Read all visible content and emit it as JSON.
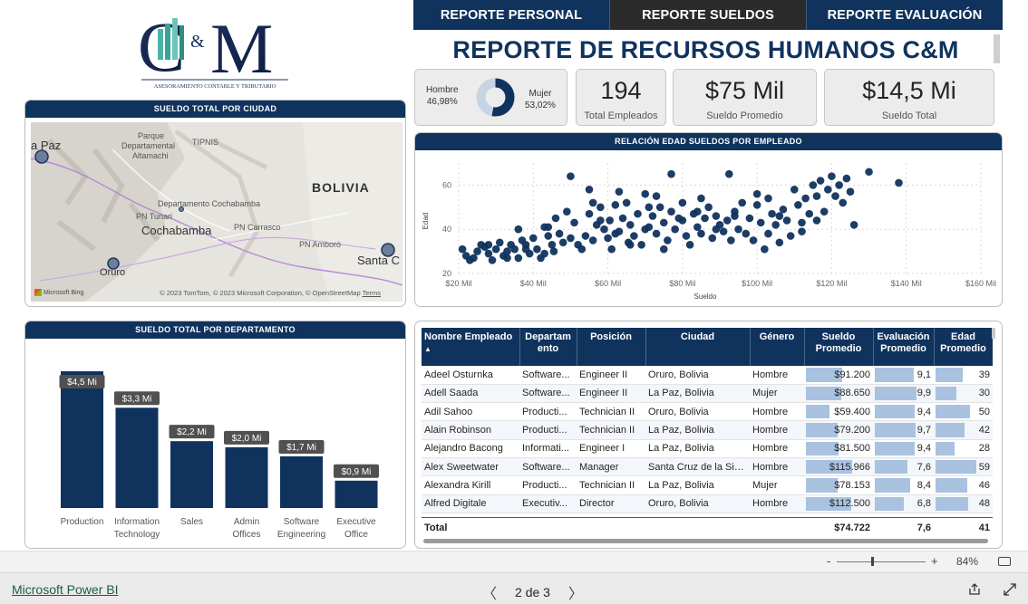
{
  "logo": {
    "mark": "C&M",
    "tagline": "ASESORAMIENTO CONTABLE Y TRIBUTARIO"
  },
  "nav": {
    "tabs": [
      {
        "label": "REPORTE PERSONAL",
        "active": false
      },
      {
        "label": "REPORTE SUELDOS",
        "active": true
      },
      {
        "label": "REPORTE EVALUACIÓN",
        "active": false
      }
    ]
  },
  "title": "REPORTE DE RECURSOS HUMANOS C&M",
  "gender": {
    "male_label": "Hombre",
    "male_pct": "46,98%",
    "male_share": 0.4698,
    "female_label": "Mujer",
    "female_pct": "53,02%",
    "female_share": 0.5302
  },
  "kpis": {
    "total_empleados": {
      "value": "194",
      "label": "Total Empleados"
    },
    "sueldo_promedio": {
      "value": "$75 Mil",
      "label": "Sueldo Promedio"
    },
    "sueldo_total": {
      "value": "$14,5 Mi",
      "label": "Sueldo Total"
    }
  },
  "map_panel": {
    "title": "SUELDO TOTAL POR CIUDAD",
    "labels": {
      "la_paz": "a Paz",
      "bolivia": "BOLIVIA",
      "parque": "Parque",
      "departamental": "Departamental",
      "altamachi": "Altamachi",
      "tipnis": "TIPNIS",
      "dep_cbba": "Departamento Cochabamba",
      "pn_tunari": "PN Tunari",
      "cochabamba": "Cochabamba",
      "pn_carrasco": "PN Carrasco",
      "pn_amboro": "PN Amboró",
      "oruro": "Oruro",
      "santa_cruz": "Santa C"
    },
    "bing": "Microsoft Bing",
    "credit": "© 2023 TomTom, © 2023 Microsoft Corporation, © OpenStreetMap",
    "terms": "Terms"
  },
  "scatter_panel": {
    "title": "RELACIÓN EDAD SUELDOS POR EMPLEADO"
  },
  "bar_panel": {
    "title": "SUELDO TOTAL POR DEPARTAMENTO"
  },
  "chart_data": [
    {
      "type": "scatter",
      "title": "RELACIÓN EDAD SUELDOS POR EMPLEADO",
      "xlabel": "Sueldo",
      "ylabel": "Edad",
      "xlim": [
        20000,
        160000
      ],
      "ylim": [
        20,
        70
      ],
      "xticks": [
        "$20 Mil",
        "$40 Mil",
        "$60 Mil",
        "$80 Mil",
        "$100 Mil",
        "$120 Mil",
        "$140 Mil",
        "$160 Mil"
      ],
      "yticks": [
        "20",
        "40",
        "60"
      ],
      "grid": true,
      "color": "#10335e",
      "points": [
        [
          21000,
          31
        ],
        [
          22000,
          28
        ],
        [
          23000,
          26
        ],
        [
          24000,
          27
        ],
        [
          25000,
          30
        ],
        [
          26000,
          33
        ],
        [
          27000,
          32
        ],
        [
          28000,
          29
        ],
        [
          29000,
          26
        ],
        [
          30000,
          31
        ],
        [
          31000,
          34
        ],
        [
          32000,
          28
        ],
        [
          33000,
          30
        ],
        [
          34000,
          33
        ],
        [
          35000,
          31
        ],
        [
          36000,
          27
        ],
        [
          37000,
          35
        ],
        [
          38000,
          33
        ],
        [
          39000,
          29
        ],
        [
          40000,
          36
        ],
        [
          41000,
          31
        ],
        [
          42000,
          27
        ],
        [
          43000,
          41
        ],
        [
          44000,
          37
        ],
        [
          45000,
          33
        ],
        [
          45500,
          30
        ],
        [
          46000,
          45
        ],
        [
          47000,
          38
        ],
        [
          48000,
          34
        ],
        [
          49000,
          48
        ],
        [
          50000,
          36
        ],
        [
          51000,
          43
        ],
        [
          52000,
          33
        ],
        [
          53000,
          31
        ],
        [
          54000,
          37
        ],
        [
          55000,
          47
        ],
        [
          56000,
          35
        ],
        [
          57000,
          42
        ],
        [
          58000,
          50
        ],
        [
          59000,
          40
        ],
        [
          60000,
          36
        ],
        [
          60500,
          44
        ],
        [
          61000,
          31
        ],
        [
          62000,
          51
        ],
        [
          63000,
          39
        ],
        [
          64000,
          45
        ],
        [
          65000,
          52
        ],
        [
          65500,
          34
        ],
        [
          66000,
          42
        ],
        [
          67000,
          37
        ],
        [
          68000,
          47
        ],
        [
          69000,
          33
        ],
        [
          70000,
          56
        ],
        [
          71000,
          41
        ],
        [
          72000,
          46
        ],
        [
          73000,
          38
        ],
        [
          74000,
          50
        ],
        [
          75000,
          43
        ],
        [
          76000,
          35
        ],
        [
          77000,
          48
        ],
        [
          78000,
          40
        ],
        [
          79000,
          45
        ],
        [
          80000,
          52
        ],
        [
          81000,
          37
        ],
        [
          82000,
          33
        ],
        [
          83000,
          47
        ],
        [
          84000,
          41
        ],
        [
          85000,
          38
        ],
        [
          86000,
          45
        ],
        [
          87000,
          50
        ],
        [
          88000,
          36
        ],
        [
          89000,
          46
        ],
        [
          90000,
          42
        ],
        [
          91000,
          39
        ],
        [
          92000,
          44
        ],
        [
          93000,
          35
        ],
        [
          94000,
          48
        ],
        [
          95000,
          40
        ],
        [
          96000,
          52
        ],
        [
          97000,
          38
        ],
        [
          98000,
          45
        ],
        [
          99000,
          35
        ],
        [
          100000,
          51
        ],
        [
          101000,
          43
        ],
        [
          102000,
          31
        ],
        [
          103000,
          38
        ],
        [
          104000,
          47
        ],
        [
          105000,
          42
        ],
        [
          106000,
          34
        ],
        [
          107000,
          49
        ],
        [
          108000,
          44
        ],
        [
          109000,
          37
        ],
        [
          110000,
          58
        ],
        [
          111000,
          51
        ],
        [
          112000,
          43
        ],
        [
          113000,
          54
        ],
        [
          114000,
          47
        ],
        [
          115000,
          60
        ],
        [
          116000,
          55
        ],
        [
          117000,
          62
        ],
        [
          118000,
          48
        ],
        [
          119000,
          58
        ],
        [
          120000,
          64
        ],
        [
          121000,
          55
        ],
        [
          122000,
          60
        ],
        [
          123000,
          52
        ],
        [
          124000,
          63
        ],
        [
          125000,
          57
        ],
        [
          126000,
          42
        ],
        [
          130000,
          66
        ],
        [
          138000,
          61
        ],
        [
          92500,
          65
        ],
        [
          77000,
          65
        ],
        [
          50000,
          64
        ],
        [
          55000,
          58
        ],
        [
          63000,
          57
        ],
        [
          73000,
          55
        ],
        [
          85000,
          54
        ],
        [
          100000,
          56
        ],
        [
          103000,
          54
        ],
        [
          56000,
          52
        ],
        [
          44000,
          41
        ],
        [
          36000,
          40
        ],
        [
          58000,
          44
        ],
        [
          70000,
          40
        ],
        [
          84000,
          48
        ],
        [
          94000,
          46
        ],
        [
          75000,
          31
        ],
        [
          66000,
          33
        ],
        [
          43000,
          29
        ],
        [
          28000,
          33
        ],
        [
          33000,
          27
        ],
        [
          38000,
          31
        ],
        [
          62000,
          38
        ],
        [
          71000,
          50
        ],
        [
          80000,
          44
        ],
        [
          89000,
          40
        ],
        [
          106000,
          46
        ],
        [
          112000,
          39
        ],
        [
          116000,
          44
        ]
      ]
    },
    {
      "type": "bar",
      "title": "SUELDO TOTAL POR DEPARTAMENTO",
      "categories": [
        "Production",
        "Information Technology",
        "Sales",
        "Admin Offices",
        "Software Engineering",
        "Executive Office"
      ],
      "values": [
        4.5,
        3.3,
        2.2,
        2.0,
        1.7,
        0.9
      ],
      "data_labels": [
        "$4,5 Mi",
        "$3,3 Mi",
        "$2,2 Mi",
        "$2,0 Mi",
        "$1,7 Mi",
        "$0,9 Mi"
      ],
      "ylim": [
        0,
        5
      ],
      "color": "#10335e"
    }
  ],
  "map_bubbles": [
    {
      "city": "La Paz"
    },
    {
      "city": "Cochabamba"
    },
    {
      "city": "Oruro"
    },
    {
      "city": "Santa Cruz"
    }
  ],
  "table": {
    "columns": [
      "Nombre Empleado",
      "Departam ento",
      "Posición",
      "Ciudad",
      "Género",
      "Sueldo Promedio",
      "Evaluación Promedio",
      "Edad Promedio"
    ],
    "sort_indicator": "▲",
    "rows": [
      {
        "name": "Adeel Osturnka",
        "dept": "Software...",
        "pos": "Engineer II",
        "city": "Oruro, Bolivia",
        "gender": "Hombre",
        "salary": "$91.200",
        "salary_n": 91200,
        "eval": "9,1",
        "eval_n": 9.1,
        "age": "39",
        "age_n": 39
      },
      {
        "name": "Adell Saada",
        "dept": "Software...",
        "pos": "Engineer II",
        "city": "La Paz, Bolivia",
        "gender": "Mujer",
        "salary": "$88.650",
        "salary_n": 88650,
        "eval": "9,9",
        "eval_n": 9.9,
        "age": "30",
        "age_n": 30
      },
      {
        "name": "Adil Sahoo",
        "dept": "Producti...",
        "pos": "Technician II",
        "city": "Oruro, Bolivia",
        "gender": "Hombre",
        "salary": "$59.400",
        "salary_n": 59400,
        "eval": "9,4",
        "eval_n": 9.4,
        "age": "50",
        "age_n": 50
      },
      {
        "name": "Alain Robinson",
        "dept": "Producti...",
        "pos": "Technician II",
        "city": "La Paz, Bolivia",
        "gender": "Hombre",
        "salary": "$79.200",
        "salary_n": 79200,
        "eval": "9,7",
        "eval_n": 9.7,
        "age": "42",
        "age_n": 42
      },
      {
        "name": "Alejandro Bacong",
        "dept": "Informati...",
        "pos": "Engineer I",
        "city": "La Paz, Bolivia",
        "gender": "Hombre",
        "salary": "$81.500",
        "salary_n": 81500,
        "eval": "9,4",
        "eval_n": 9.4,
        "age": "28",
        "age_n": 28
      },
      {
        "name": "Alex Sweetwater",
        "dept": "Software...",
        "pos": "Manager",
        "city": "Santa Cruz de la Sie...",
        "gender": "Hombre",
        "salary": "$115.966",
        "salary_n": 115966,
        "eval": "7,6",
        "eval_n": 7.6,
        "age": "59",
        "age_n": 59
      },
      {
        "name": "Alexandra Kirill",
        "dept": "Producti...",
        "pos": "Technician II",
        "city": "La Paz, Bolivia",
        "gender": "Mujer",
        "salary": "$78.153",
        "salary_n": 78153,
        "eval": "8,4",
        "eval_n": 8.4,
        "age": "46",
        "age_n": 46
      },
      {
        "name": "Alfred Digitale",
        "dept": "Executiv...",
        "pos": "Director",
        "city": "Oruro, Bolivia",
        "gender": "Hombre",
        "salary": "$112.500",
        "salary_n": 112500,
        "eval": "6,8",
        "eval_n": 6.8,
        "age": "48",
        "age_n": 48
      }
    ],
    "total": {
      "label": "Total",
      "salary": "$74.722",
      "eval": "7,6",
      "age": "41"
    }
  },
  "zoom": {
    "minus": "-",
    "plus": "+",
    "level": "84%",
    "value": 0.84
  },
  "footer": {
    "brand": "Microsoft Power BI",
    "page": "2 de 3",
    "prev": "〈",
    "next": "〉"
  }
}
